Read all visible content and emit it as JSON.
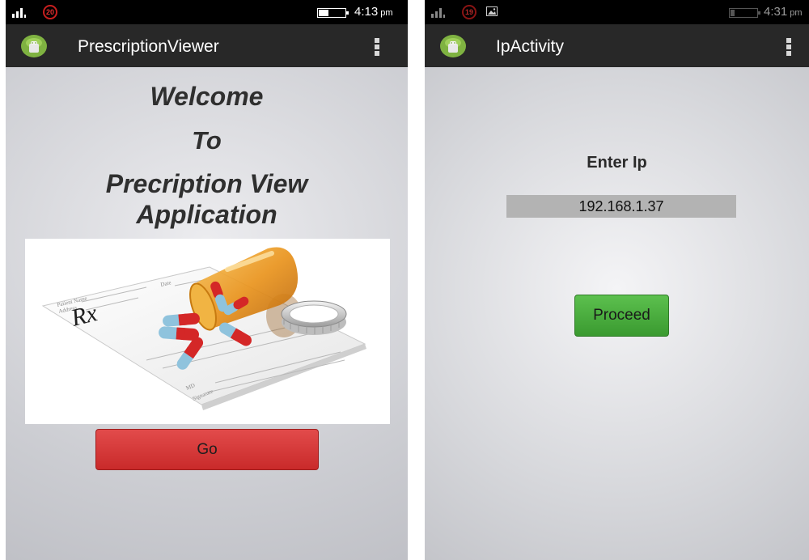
{
  "screens": [
    {
      "status_bar": {
        "notification_badge": "20",
        "time": "4:13",
        "ampm": "pm",
        "battery_level": 0.35
      },
      "action_bar": {
        "title": "PrescriptionViewer",
        "app_icon": "android-icon",
        "overflow_icon": "overflow-menu-icon"
      },
      "content": {
        "headline_lines": [
          "Welcome",
          "To",
          "Precription View",
          "Application"
        ],
        "prescription_text": {
          "rx": "Rx",
          "patient_name": "Patient Name",
          "address": "Address",
          "date": "Date",
          "md": "MD",
          "signature": "Signature"
        },
        "go_label": "Go"
      },
      "colors": {
        "button": "#d63838"
      }
    },
    {
      "status_bar": {
        "notification_badge": "19",
        "time": "4:31",
        "ampm": "pm",
        "battery_level": 0.15
      },
      "action_bar": {
        "title": "IpActivity",
        "app_icon": "android-icon",
        "overflow_icon": "overflow-menu-icon"
      },
      "content": {
        "label": "Enter Ip",
        "ip_value": "192.168.1.37",
        "proceed_label": "Proceed"
      },
      "colors": {
        "button": "#4caf3f"
      }
    }
  ]
}
